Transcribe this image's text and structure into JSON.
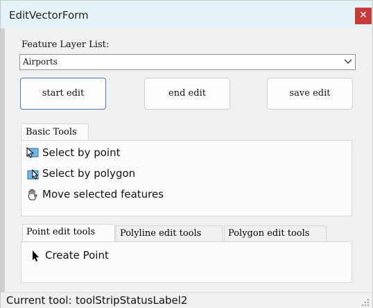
{
  "window": {
    "title": "EditVectorForm",
    "close_glyph": "✕"
  },
  "layer": {
    "label": "Feature Layer List:",
    "selected": "Airports"
  },
  "buttons": {
    "start": "start edit",
    "end": "end edit",
    "save": "save edit"
  },
  "basic_tools": {
    "tab": "Basic Tools",
    "items": [
      {
        "label": "Select by point",
        "icon": "select-by-point-icon"
      },
      {
        "label": "Select by polygon",
        "icon": "select-by-polygon-icon"
      },
      {
        "label": "Move selected features",
        "icon": "hand-icon"
      }
    ]
  },
  "edit_tabs": {
    "tabs": [
      "Point edit tools",
      "Polyline edit tools",
      "Polygon edit tools"
    ],
    "active": "Point edit tools",
    "create_point": "Create Point"
  },
  "status": {
    "label": "Current tool:",
    "value": "toolStripStatusLabel2"
  },
  "colors": {
    "titlebar": "#e6f3f6",
    "close": "#c73b3b",
    "focus_border": "#4a78c8"
  }
}
